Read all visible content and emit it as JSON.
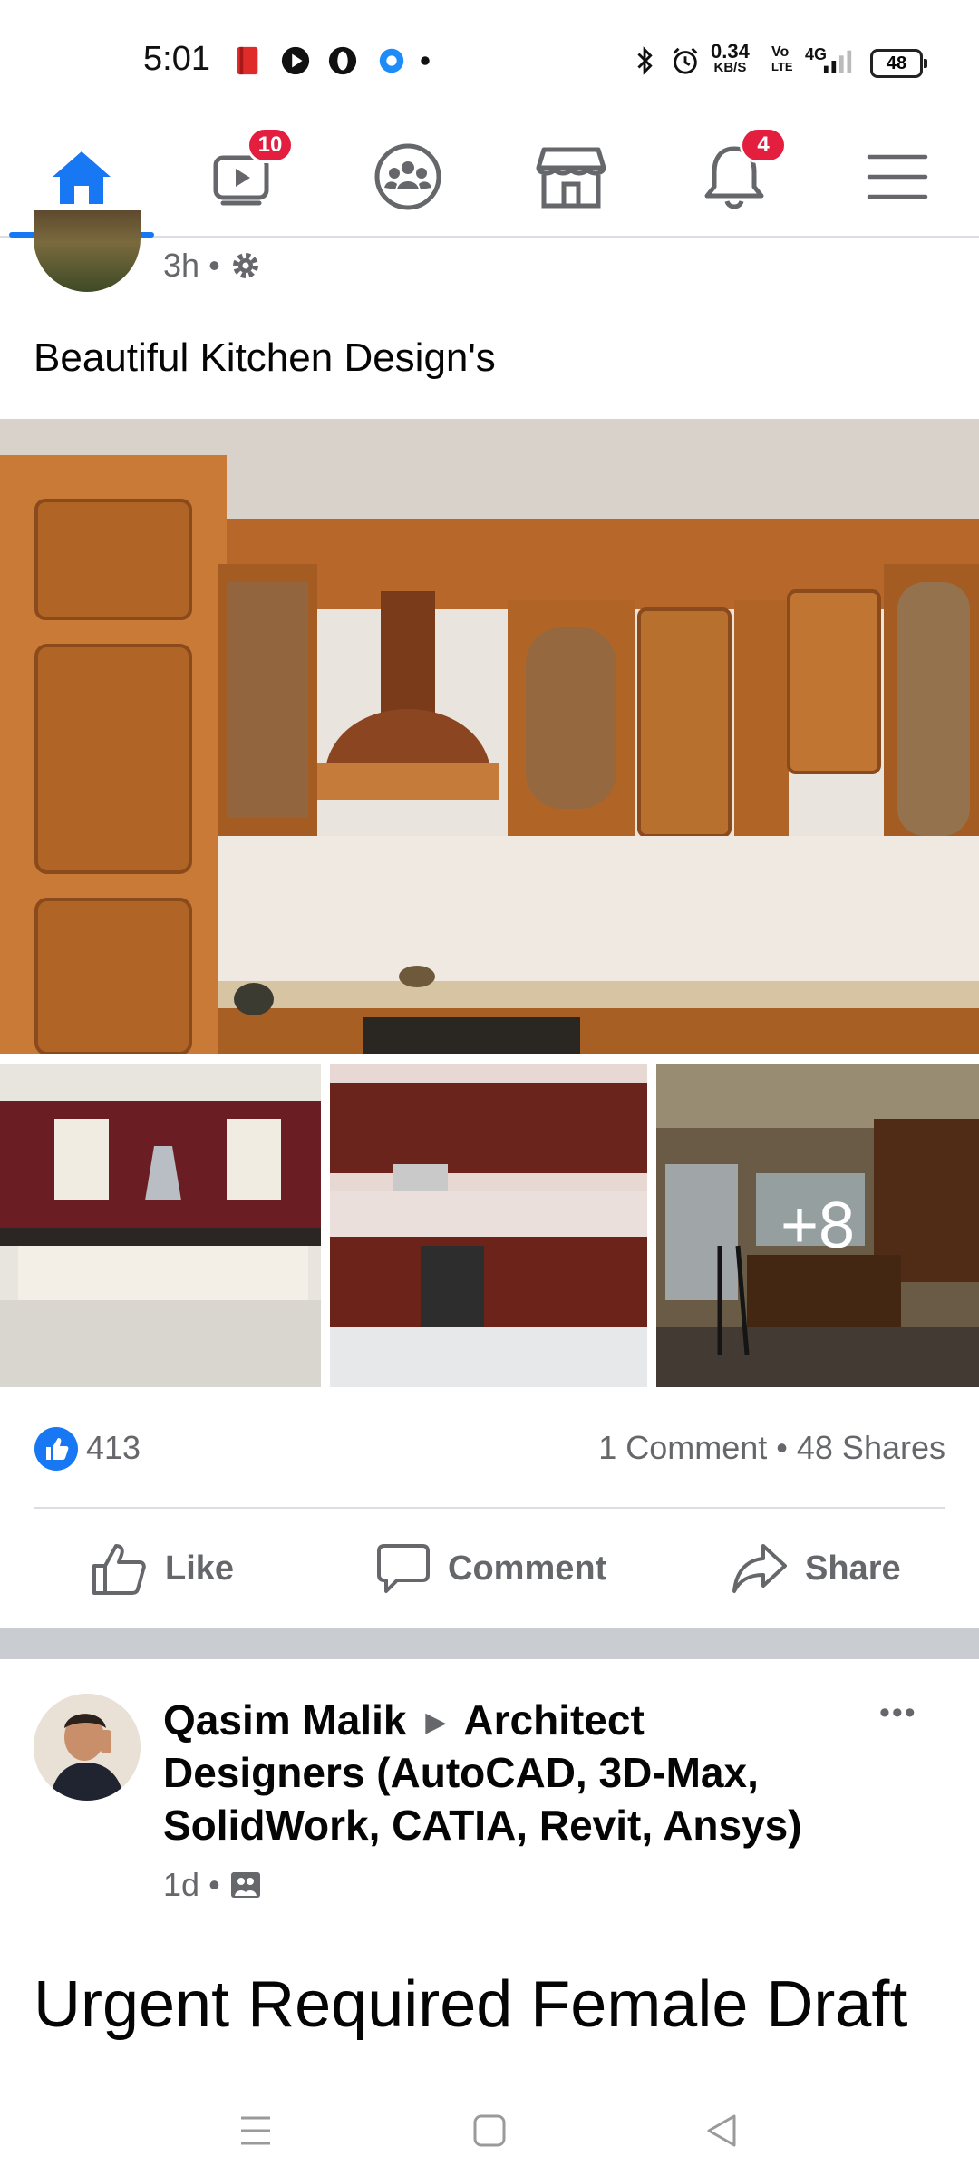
{
  "status_bar": {
    "time": "5:01",
    "net_speed_value": "0.34",
    "net_speed_unit": "KB/S",
    "volte": "Vo\nLTE",
    "network": "4G",
    "battery": "48"
  },
  "nav": {
    "items": [
      {
        "name": "home",
        "badge": ""
      },
      {
        "name": "watch",
        "badge": "10"
      },
      {
        "name": "groups",
        "badge": ""
      },
      {
        "name": "marketplace",
        "badge": ""
      },
      {
        "name": "notifications",
        "badge": "4"
      },
      {
        "name": "menu",
        "badge": ""
      }
    ]
  },
  "post1": {
    "time": "3h",
    "text": "Beautiful Kitchen Design's",
    "more_photos": "+8",
    "reactions": "413",
    "comments_shares": "1 Comment • 48 Shares",
    "actions": {
      "like": "Like",
      "comment": "Comment",
      "share": "Share"
    }
  },
  "post2": {
    "author": "Qasim Malik",
    "arrow": "▶",
    "group_line1": "Architect",
    "group_line2": "Designers (AutoCAD, 3D-Max,",
    "group_line3": "SolidWork, CATIA, Revit, Ansys)",
    "time": "1d",
    "text": "Urgent Required Female Draft",
    "more": "•••"
  },
  "colors": {
    "accent": "#1877f2",
    "badge": "#e41e3f",
    "muted": "#65676b",
    "divider": "#c9ccd1"
  }
}
